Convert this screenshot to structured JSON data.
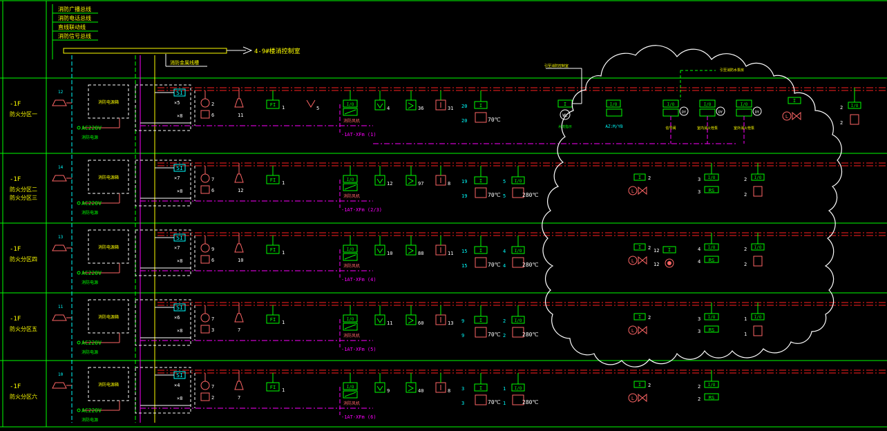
{
  "colors": {
    "frame": "#00ff00",
    "device": "#00ff00",
    "alarm": "#ff6666",
    "bus": "#ff00ff",
    "redline": "#ff2020",
    "white": "#ffffff",
    "cyan": "#00ffff",
    "yellow": "#ffff00"
  },
  "legend": {
    "lines": [
      "消防广播总线",
      "消防电话总线",
      "直线联动线",
      "消防信号总线"
    ],
    "arrow_text": "4-9#楼消控制室",
    "tray_label": "消防金属线槽"
  },
  "cloud": {
    "notes": [
      "引至消防控制室",
      "引至消防水泵房"
    ]
  },
  "floors": [
    {
      "name": "-1F",
      "zone": "防火分区一",
      "input_count": "12",
      "speaker_count": "11",
      "box_label": "消防电源箱",
      "ac_label": "AC220V",
      "power_label": "消防电源",
      "si_label": "SI",
      "x_top": "×5",
      "x_bottom": "×8",
      "phone_count": "2",
      "phone2_count": "6",
      "fi_count": "1",
      "y_count": "5",
      "io_label": "I/O",
      "fan_label": "消防风机",
      "fan_code": "-1AT-XFm (1)",
      "d1_count": "4",
      "d2_count": "36",
      "d3_count": "31",
      "t70_left": "20",
      "t70_right": "20",
      "t70_label": "70℃",
      "extra": [
        {
          "label": "WL",
          "caption": "水流指示"
        },
        {
          "label": "AZ:M/YB",
          "caption": "AZ:M/YB"
        },
        {
          "label": "DY",
          "caption": "信号阀"
        },
        {
          "label": "DY",
          "caption": "室内消火栓泵"
        },
        {
          "label": "DY",
          "caption": "室外消火栓泵"
        }
      ],
      "right_left": "2",
      "right_left2": "2"
    },
    {
      "name": "-1F",
      "zone": "防火分区二\n防火分区三",
      "input_count": "14",
      "speaker_count": "12",
      "box_label": "消防电源箱",
      "ac_label": "AC220V",
      "power_label": "消防电源",
      "si_label": "SI",
      "x_top": "×7",
      "x_bottom": "×8",
      "phone_count": "7",
      "phone2_count": "6",
      "fi_count": "1",
      "io_label": "I/O",
      "fan_label": "消防风机",
      "fan_code": "-1AT-XFm (2/3)",
      "d1_count": "12",
      "d2_count": "97",
      "d3_count": "8",
      "t70_left": "19",
      "t70_right": "19",
      "t70_label": "70℃",
      "t280_left": "5",
      "t280_right": "5",
      "t280_label": "280℃",
      "valve_count": "2",
      "rs_left": "3",
      "rs_left2": "3",
      "rs_label": "RS",
      "io2_left": "2",
      "io2_left2": "2"
    },
    {
      "name": "-1F",
      "zone": "防火分区四",
      "input_count": "13",
      "speaker_count": "10",
      "box_label": "消防电源箱",
      "ac_label": "AC220V",
      "power_label": "消防电源",
      "si_label": "SI",
      "x_top": "×7",
      "x_bottom": "×8",
      "phone_count": "9",
      "phone2_count": "6",
      "fi_count": "1",
      "io_label": "I/O",
      "fan_label": "消防风机",
      "fan_code": "-1AT-XFm (4)",
      "d1_count": "10",
      "d2_count": "88",
      "d3_count": "11",
      "t70_left": "15",
      "t70_right": "15",
      "t70_label": "70℃",
      "t280_left": "4",
      "t280_right": "4",
      "t280_label": "280℃",
      "valve_count": "2",
      "pump_left": "12",
      "pump_left2": "12",
      "rs_left": "4",
      "rs_left2": "4",
      "rs_label": "RS",
      "io2_left": "2",
      "io2_left2": "2"
    },
    {
      "name": "-1F",
      "zone": "防火分区五",
      "input_count": "11",
      "speaker_count": "7",
      "box_label": "消防电源箱",
      "ac_label": "AC220V",
      "power_label": "消防电源",
      "si_label": "SI",
      "x_top": "×6",
      "x_bottom": "×8",
      "phone_count": "7",
      "phone2_count": "3",
      "fi_count": "1",
      "io_label": "I/O",
      "fan_label": "消防风机",
      "fan_code": "-1AT-XFm (5)",
      "d1_count": "11",
      "d2_count": "60",
      "d3_count": "13",
      "t70_left": "9",
      "t70_right": "9",
      "t70_label": "70℃",
      "t280_left": "2",
      "t280_right": "2",
      "t280_label": "280℃",
      "valve_count": "2",
      "rs_left": "3",
      "rs_left2": "3",
      "rs_label": "RS",
      "io2_left": "1",
      "io2_left2": "1"
    },
    {
      "name": "-1F",
      "zone": "防火分区六",
      "input_count": "10",
      "speaker_count": "7",
      "box_label": "消防电源箱",
      "ac_label": "AC220V",
      "power_label": "消防电源",
      "si_label": "SI",
      "x_top": "×4",
      "x_bottom": "×8",
      "phone_count": "7",
      "phone2_count": "2",
      "fi_count": "1",
      "io_label": "I/O",
      "fan_label": "消防风机",
      "fan_code": "-1AT-XFm (6)",
      "d1_count": "9",
      "d2_count": "40",
      "d3_count": "8",
      "t70_left": "3",
      "t70_right": "3",
      "t70_label": "70℃",
      "t280_left": "1",
      "t280_right": "1",
      "t280_label": "280℃",
      "valve_count": "2",
      "rs_left": "2",
      "rs_left2": "2",
      "rs_label": "RS"
    }
  ]
}
